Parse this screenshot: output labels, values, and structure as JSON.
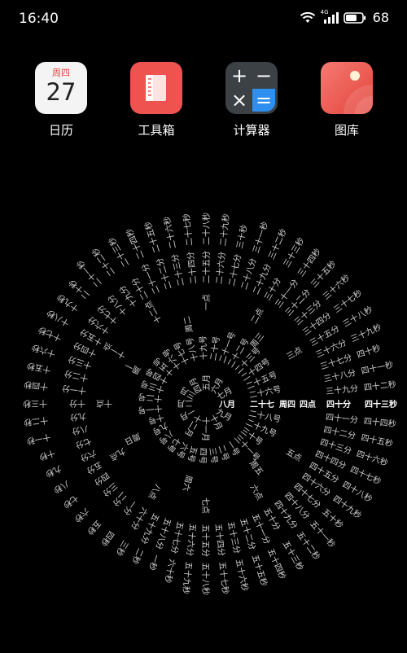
{
  "status_bar": {
    "time": "16:40",
    "network": "4G",
    "battery": "68"
  },
  "apps": [
    {
      "name": "日历",
      "icon": "calendar-icon",
      "weekday": "周四",
      "day": "27"
    },
    {
      "name": "工具箱",
      "icon": "toolbox-icon"
    },
    {
      "name": "计算器",
      "icon": "calculator-icon",
      "keys": [
        "+",
        "−",
        "×",
        "="
      ]
    },
    {
      "name": "图库",
      "icon": "gallery-icon"
    }
  ],
  "text_clock": {
    "current": {
      "month": "八月",
      "day": "二十七",
      "weekday": "周四",
      "hour": "四点",
      "minute": "四十分",
      "second": "四十三秒"
    },
    "months": [
      "一月",
      "二月",
      "三月",
      "四月",
      "五月",
      "六月",
      "七月",
      "八月",
      "九月",
      "十月",
      "十一月",
      "十二月"
    ],
    "days": [
      "一号",
      "二号",
      "三号",
      "四号",
      "五号",
      "六号",
      "七号",
      "八号",
      "九号",
      "十号",
      "十一号",
      "十二号",
      "十三号",
      "十四号",
      "十五号",
      "十六号",
      "十七号",
      "十八号",
      "十九号",
      "二十号",
      "二十一号",
      "二十二号",
      "二十三号",
      "二十四号",
      "二十五号",
      "二十六号",
      "二十七号",
      "二十八号",
      "二十九号",
      "三十号",
      "三十一号"
    ],
    "weekdays": [
      "周一",
      "周二",
      "周三",
      "周四",
      "周五",
      "周六",
      "周日"
    ],
    "hours": [
      "一点",
      "二点",
      "三点",
      "四点",
      "五点",
      "六点",
      "七点",
      "八点",
      "九点",
      "十点",
      "十一点",
      "十二点"
    ],
    "minutes": [
      "一分",
      "二分",
      "三分",
      "四分",
      "五分",
      "六分",
      "七分",
      "八分",
      "九分",
      "十分",
      "十一分",
      "十二分",
      "十三分",
      "十四分",
      "十五分",
      "十六分",
      "十七分",
      "十八分",
      "十九分",
      "二十分",
      "二十一分",
      "二十二分",
      "二十三分",
      "二十四分",
      "二十五分",
      "二十六分",
      "二十七分",
      "二十八分",
      "二十九分",
      "三十分",
      "三十一分",
      "三十二分",
      "三十三分",
      "三十四分",
      "三十五分",
      "三十六分",
      "三十七分",
      "三十八分",
      "三十九分",
      "四十分",
      "四十一分",
      "四十二分",
      "四十三分",
      "四十四分",
      "四十五分",
      "四十六分",
      "四十七分",
      "四十八分",
      "四十九分",
      "五十分",
      "五十一分",
      "五十二分",
      "五十三分",
      "五十四分",
      "五十五分",
      "五十六分",
      "五十七分",
      "五十八分",
      "五十九分",
      "六十分"
    ],
    "seconds": [
      "一秒",
      "二秒",
      "三秒",
      "四秒",
      "五秒",
      "六秒",
      "七秒",
      "八秒",
      "九秒",
      "十秒",
      "十一秒",
      "十二秒",
      "十三秒",
      "十四秒",
      "十五秒",
      "十六秒",
      "十七秒",
      "十八秒",
      "十九秒",
      "二十秒",
      "二十一秒",
      "二十二秒",
      "二十三秒",
      "二十四秒",
      "二十五秒",
      "二十六秒",
      "二十七秒",
      "二十八秒",
      "二十九秒",
      "三十秒",
      "三十一秒",
      "三十二秒",
      "三十三秒",
      "三十四秒",
      "三十五秒",
      "三十六秒",
      "三十七秒",
      "三十八秒",
      "三十九秒",
      "四十秒",
      "四十一秒",
      "四十二秒",
      "四十三秒",
      "四十四秒",
      "四十五秒",
      "四十六秒",
      "四十七秒",
      "四十八秒",
      "四十九秒",
      "五十秒",
      "五十一秒",
      "五十二秒",
      "五十三秒",
      "五十四秒",
      "五十五秒",
      "五十六秒",
      "五十七秒",
      "五十八秒",
      "五十九秒",
      "六十秒"
    ]
  }
}
